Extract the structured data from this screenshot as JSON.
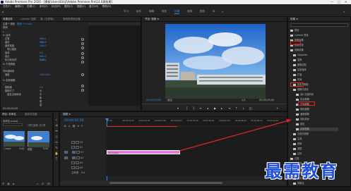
{
  "titlebar": {
    "text": "Adobe Premiere Pro 2020 - [模板\\Users\\Ed试\\Adobe Premiere Pro\\14.0源效果]",
    "controls": [
      "—",
      "□",
      "✕"
    ]
  },
  "menu": [
    "文件(F)",
    "编辑(E)",
    "剪辑(C)",
    "序列(S)",
    "标记(M)",
    "图形(G)",
    "视图(V)",
    "窗口(W)",
    "帮助(H)"
  ],
  "workspaces": [
    {
      "label": "学习",
      "active": false
    },
    {
      "label": "组件",
      "active": false
    },
    {
      "label": "编辑",
      "active": false
    },
    {
      "label": "颜色",
      "active": false
    },
    {
      "label": "效果",
      "active": true
    },
    {
      "label": "音频",
      "active": false
    },
    {
      "label": "图形",
      "active": false
    },
    {
      "label": "库",
      "active": false
    }
  ],
  "effect_controls": {
    "tabs": [
      "效果控件",
      "Lumetri 范围",
      "源: (无剪辑)",
      "音频剪辑混合器"
    ],
    "rows": [
      {
        "label": "主要 * 视频",
        "value": "视频 * 1.mp4"
      },
      {
        "label": "视频",
        "value": ""
      },
      {
        "label": "fx 运动",
        "value": ""
      },
      {
        "label": "位置",
        "value": "960.0  540.0"
      },
      {
        "label": "缩放",
        "value": "100.0"
      },
      {
        "label": "缩放宽度",
        "value": "100.0"
      },
      {
        "label": "等比缩放",
        "value": ""
      },
      {
        "label": "旋转",
        "value": "0.0"
      },
      {
        "label": "锚点",
        "value": "960.0  540.0"
      },
      {
        "label": "防闪烁滤镜",
        "value": "0.00"
      },
      {
        "label": "fx 不透明度",
        "value": ""
      },
      {
        "label": "时间重映射",
        "value": ""
      },
      {
        "label": "速度",
        "value": "100.00%"
      },
      {
        "label": "fx 高斯模糊",
        "value": ""
      },
      {
        "label": "模糊度",
        "value": "0.0"
      },
      {
        "label": "模糊尺寸",
        "value": "水平和垂直"
      },
      {
        "label": "重复边缘像素",
        "value": ""
      }
    ],
    "timecode": "00;00;00;00"
  },
  "program_monitor": {
    "tab": "节目: 视频 ≡",
    "timecode_left": "00;00;00;00",
    "fit": "适合",
    "quality": "1/2",
    "timecode_right": "00;00;05;00"
  },
  "project": {
    "tabs": [
      "项目: 未命名",
      "媒体浏览器"
    ],
    "name": "未命名.prproj",
    "count": "1项已选择, 共2项",
    "items": [
      {
        "name": "1.mp4",
        "duration": "5;00"
      },
      {
        "name": "视频",
        "duration": "5;00"
      }
    ]
  },
  "timeline": {
    "tab": "视频 ≡",
    "timecode": "00;00;00;00",
    "ruler": [
      "00;00",
      "00;00;01;00",
      "00;00;02;00",
      "00;00;03;00",
      "00;00;04;00",
      "00;00;05;00",
      "00;00;06;00",
      "00;00;07;00",
      "00;00;08;00",
      "00;00;09;00",
      "00;00;10;00"
    ],
    "tracks": [
      "V3",
      "V2",
      "V1",
      "A1",
      "A2",
      "A3",
      "主声道"
    ],
    "master_value": "0.0",
    "clip_label": "fx 1.mp4"
  },
  "effects": {
    "tab": "效果 ≡",
    "folders": [
      "预设",
      "Lumetri 预设",
      "音频效果",
      "音频过渡",
      "视频效果",
      "Obsolete",
      "变换",
      "图像控制",
      "实用程序",
      "扩曲",
      "时间",
      "杂色与颗粒",
      "模糊与锐化",
      "减少交错闪烁",
      "复合模糊",
      "方向模糊",
      "相机模糊",
      "通道模糊",
      "钝化蒙版",
      "锐化",
      "高斯模糊",
      "沉浸式视频",
      "生成",
      "视频",
      "调整",
      "过时",
      "过渡",
      "透视",
      "通道",
      "键控",
      "颜色校正",
      "风格化"
    ],
    "highlight_index": 20
  },
  "watermark": "最需教育",
  "colors": {
    "accent": "#2d8ceb",
    "clip_pink": "#e17ad6",
    "highlight_red": "#e0282a",
    "watermark": "#1e4ed8",
    "playhead": "#2d8ceb"
  }
}
